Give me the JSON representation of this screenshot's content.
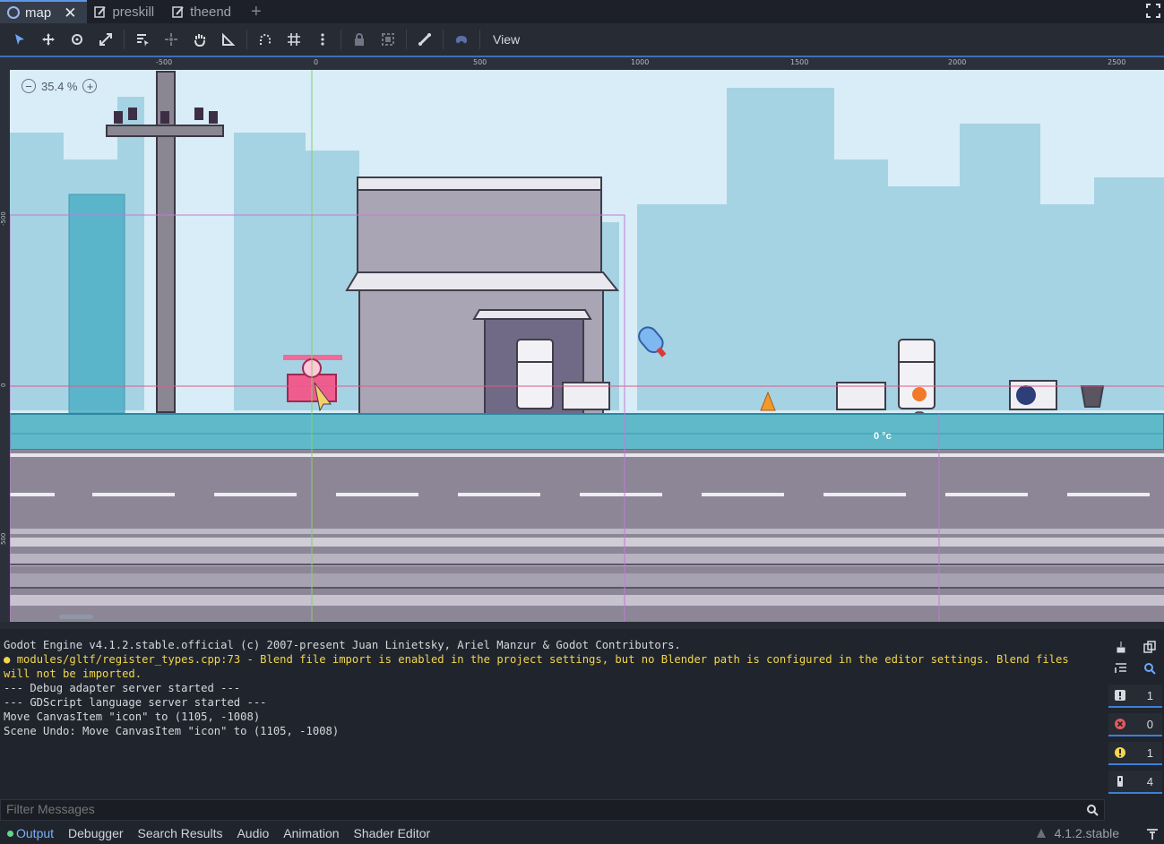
{
  "scene_tabs": [
    {
      "label": "map",
      "icon": "circle-node-icon",
      "active": true
    },
    {
      "label": "preskill",
      "icon": "script-icon"
    },
    {
      "label": "theend",
      "icon": "script-icon"
    }
  ],
  "toolbar": {
    "view_label": "View"
  },
  "viewport": {
    "zoom": "35.4 %",
    "ruler_labels": [
      "-500",
      "0",
      "500",
      "1000",
      "1500",
      "2000",
      "2500"
    ],
    "ruler_left_labels": [
      "-500",
      "0",
      "500"
    ],
    "temperature_label": "0 °c"
  },
  "output": {
    "lines": [
      {
        "text": "Godot Engine v4.1.2.stable.official (c) 2007-present Juan Linietsky, Ariel Manzur & Godot Contributors.",
        "kind": "info"
      },
      {
        "text": "modules/gltf/register_types.cpp:73 - Blend file import is enabled in the project settings, but no Blender path is configured in the editor settings. Blend files will not be imported.",
        "kind": "warning"
      },
      {
        "text": "--- Debug adapter server started ---",
        "kind": "info"
      },
      {
        "text": "--- GDScript language server started ---",
        "kind": "info"
      },
      {
        "text": "Move CanvasItem \"icon\" to (1105, -1008)",
        "kind": "info"
      },
      {
        "text": "Scene Undo: Move CanvasItem \"icon\" to (1105, -1008)",
        "kind": "info"
      }
    ],
    "counters": {
      "messages": "1",
      "errors": "0",
      "warnings": "1",
      "editor": "4"
    },
    "filter_placeholder": "Filter Messages"
  },
  "bottom_tabs": [
    "Output",
    "Debugger",
    "Search Results",
    "Audio",
    "Animation",
    "Shader Editor"
  ],
  "version": "4.1.2.stable",
  "colors": {
    "accent": "#5f95e6",
    "warning": "#f2d74c",
    "error": "#e05c5c",
    "sky": "#d8edf7"
  }
}
